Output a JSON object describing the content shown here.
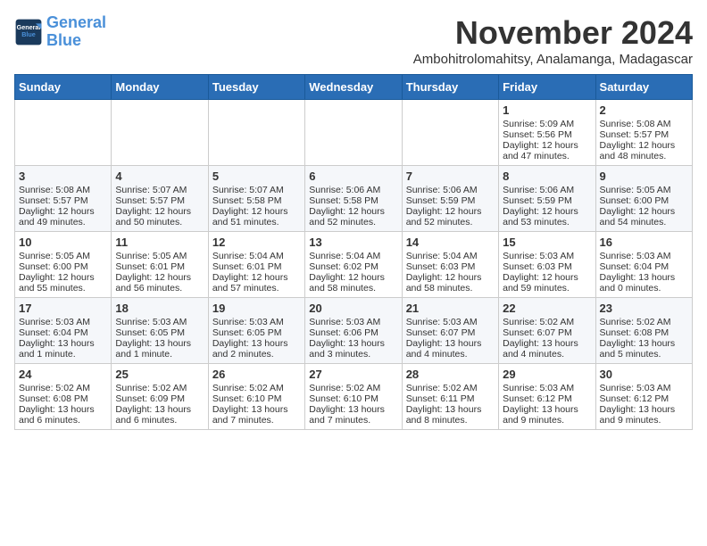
{
  "logo": {
    "line1": "General",
    "line2": "Blue"
  },
  "title": "November 2024",
  "location": "Ambohitrolomahitsy, Analamanga, Madagascar",
  "weekdays": [
    "Sunday",
    "Monday",
    "Tuesday",
    "Wednesday",
    "Thursday",
    "Friday",
    "Saturday"
  ],
  "weeks": [
    [
      {
        "day": "",
        "info": ""
      },
      {
        "day": "",
        "info": ""
      },
      {
        "day": "",
        "info": ""
      },
      {
        "day": "",
        "info": ""
      },
      {
        "day": "",
        "info": ""
      },
      {
        "day": "1",
        "info": "Sunrise: 5:09 AM\nSunset: 5:56 PM\nDaylight: 12 hours\nand 47 minutes."
      },
      {
        "day": "2",
        "info": "Sunrise: 5:08 AM\nSunset: 5:57 PM\nDaylight: 12 hours\nand 48 minutes."
      }
    ],
    [
      {
        "day": "3",
        "info": "Sunrise: 5:08 AM\nSunset: 5:57 PM\nDaylight: 12 hours\nand 49 minutes."
      },
      {
        "day": "4",
        "info": "Sunrise: 5:07 AM\nSunset: 5:57 PM\nDaylight: 12 hours\nand 50 minutes."
      },
      {
        "day": "5",
        "info": "Sunrise: 5:07 AM\nSunset: 5:58 PM\nDaylight: 12 hours\nand 51 minutes."
      },
      {
        "day": "6",
        "info": "Sunrise: 5:06 AM\nSunset: 5:58 PM\nDaylight: 12 hours\nand 52 minutes."
      },
      {
        "day": "7",
        "info": "Sunrise: 5:06 AM\nSunset: 5:59 PM\nDaylight: 12 hours\nand 52 minutes."
      },
      {
        "day": "8",
        "info": "Sunrise: 5:06 AM\nSunset: 5:59 PM\nDaylight: 12 hours\nand 53 minutes."
      },
      {
        "day": "9",
        "info": "Sunrise: 5:05 AM\nSunset: 6:00 PM\nDaylight: 12 hours\nand 54 minutes."
      }
    ],
    [
      {
        "day": "10",
        "info": "Sunrise: 5:05 AM\nSunset: 6:00 PM\nDaylight: 12 hours\nand 55 minutes."
      },
      {
        "day": "11",
        "info": "Sunrise: 5:05 AM\nSunset: 6:01 PM\nDaylight: 12 hours\nand 56 minutes."
      },
      {
        "day": "12",
        "info": "Sunrise: 5:04 AM\nSunset: 6:01 PM\nDaylight: 12 hours\nand 57 minutes."
      },
      {
        "day": "13",
        "info": "Sunrise: 5:04 AM\nSunset: 6:02 PM\nDaylight: 12 hours\nand 58 minutes."
      },
      {
        "day": "14",
        "info": "Sunrise: 5:04 AM\nSunset: 6:03 PM\nDaylight: 12 hours\nand 58 minutes."
      },
      {
        "day": "15",
        "info": "Sunrise: 5:03 AM\nSunset: 6:03 PM\nDaylight: 12 hours\nand 59 minutes."
      },
      {
        "day": "16",
        "info": "Sunrise: 5:03 AM\nSunset: 6:04 PM\nDaylight: 13 hours\nand 0 minutes."
      }
    ],
    [
      {
        "day": "17",
        "info": "Sunrise: 5:03 AM\nSunset: 6:04 PM\nDaylight: 13 hours\nand 1 minute."
      },
      {
        "day": "18",
        "info": "Sunrise: 5:03 AM\nSunset: 6:05 PM\nDaylight: 13 hours\nand 1 minute."
      },
      {
        "day": "19",
        "info": "Sunrise: 5:03 AM\nSunset: 6:05 PM\nDaylight: 13 hours\nand 2 minutes."
      },
      {
        "day": "20",
        "info": "Sunrise: 5:03 AM\nSunset: 6:06 PM\nDaylight: 13 hours\nand 3 minutes."
      },
      {
        "day": "21",
        "info": "Sunrise: 5:03 AM\nSunset: 6:07 PM\nDaylight: 13 hours\nand 4 minutes."
      },
      {
        "day": "22",
        "info": "Sunrise: 5:02 AM\nSunset: 6:07 PM\nDaylight: 13 hours\nand 4 minutes."
      },
      {
        "day": "23",
        "info": "Sunrise: 5:02 AM\nSunset: 6:08 PM\nDaylight: 13 hours\nand 5 minutes."
      }
    ],
    [
      {
        "day": "24",
        "info": "Sunrise: 5:02 AM\nSunset: 6:08 PM\nDaylight: 13 hours\nand 6 minutes."
      },
      {
        "day": "25",
        "info": "Sunrise: 5:02 AM\nSunset: 6:09 PM\nDaylight: 13 hours\nand 6 minutes."
      },
      {
        "day": "26",
        "info": "Sunrise: 5:02 AM\nSunset: 6:10 PM\nDaylight: 13 hours\nand 7 minutes."
      },
      {
        "day": "27",
        "info": "Sunrise: 5:02 AM\nSunset: 6:10 PM\nDaylight: 13 hours\nand 7 minutes."
      },
      {
        "day": "28",
        "info": "Sunrise: 5:02 AM\nSunset: 6:11 PM\nDaylight: 13 hours\nand 8 minutes."
      },
      {
        "day": "29",
        "info": "Sunrise: 5:03 AM\nSunset: 6:12 PM\nDaylight: 13 hours\nand 9 minutes."
      },
      {
        "day": "30",
        "info": "Sunrise: 5:03 AM\nSunset: 6:12 PM\nDaylight: 13 hours\nand 9 minutes."
      }
    ]
  ]
}
